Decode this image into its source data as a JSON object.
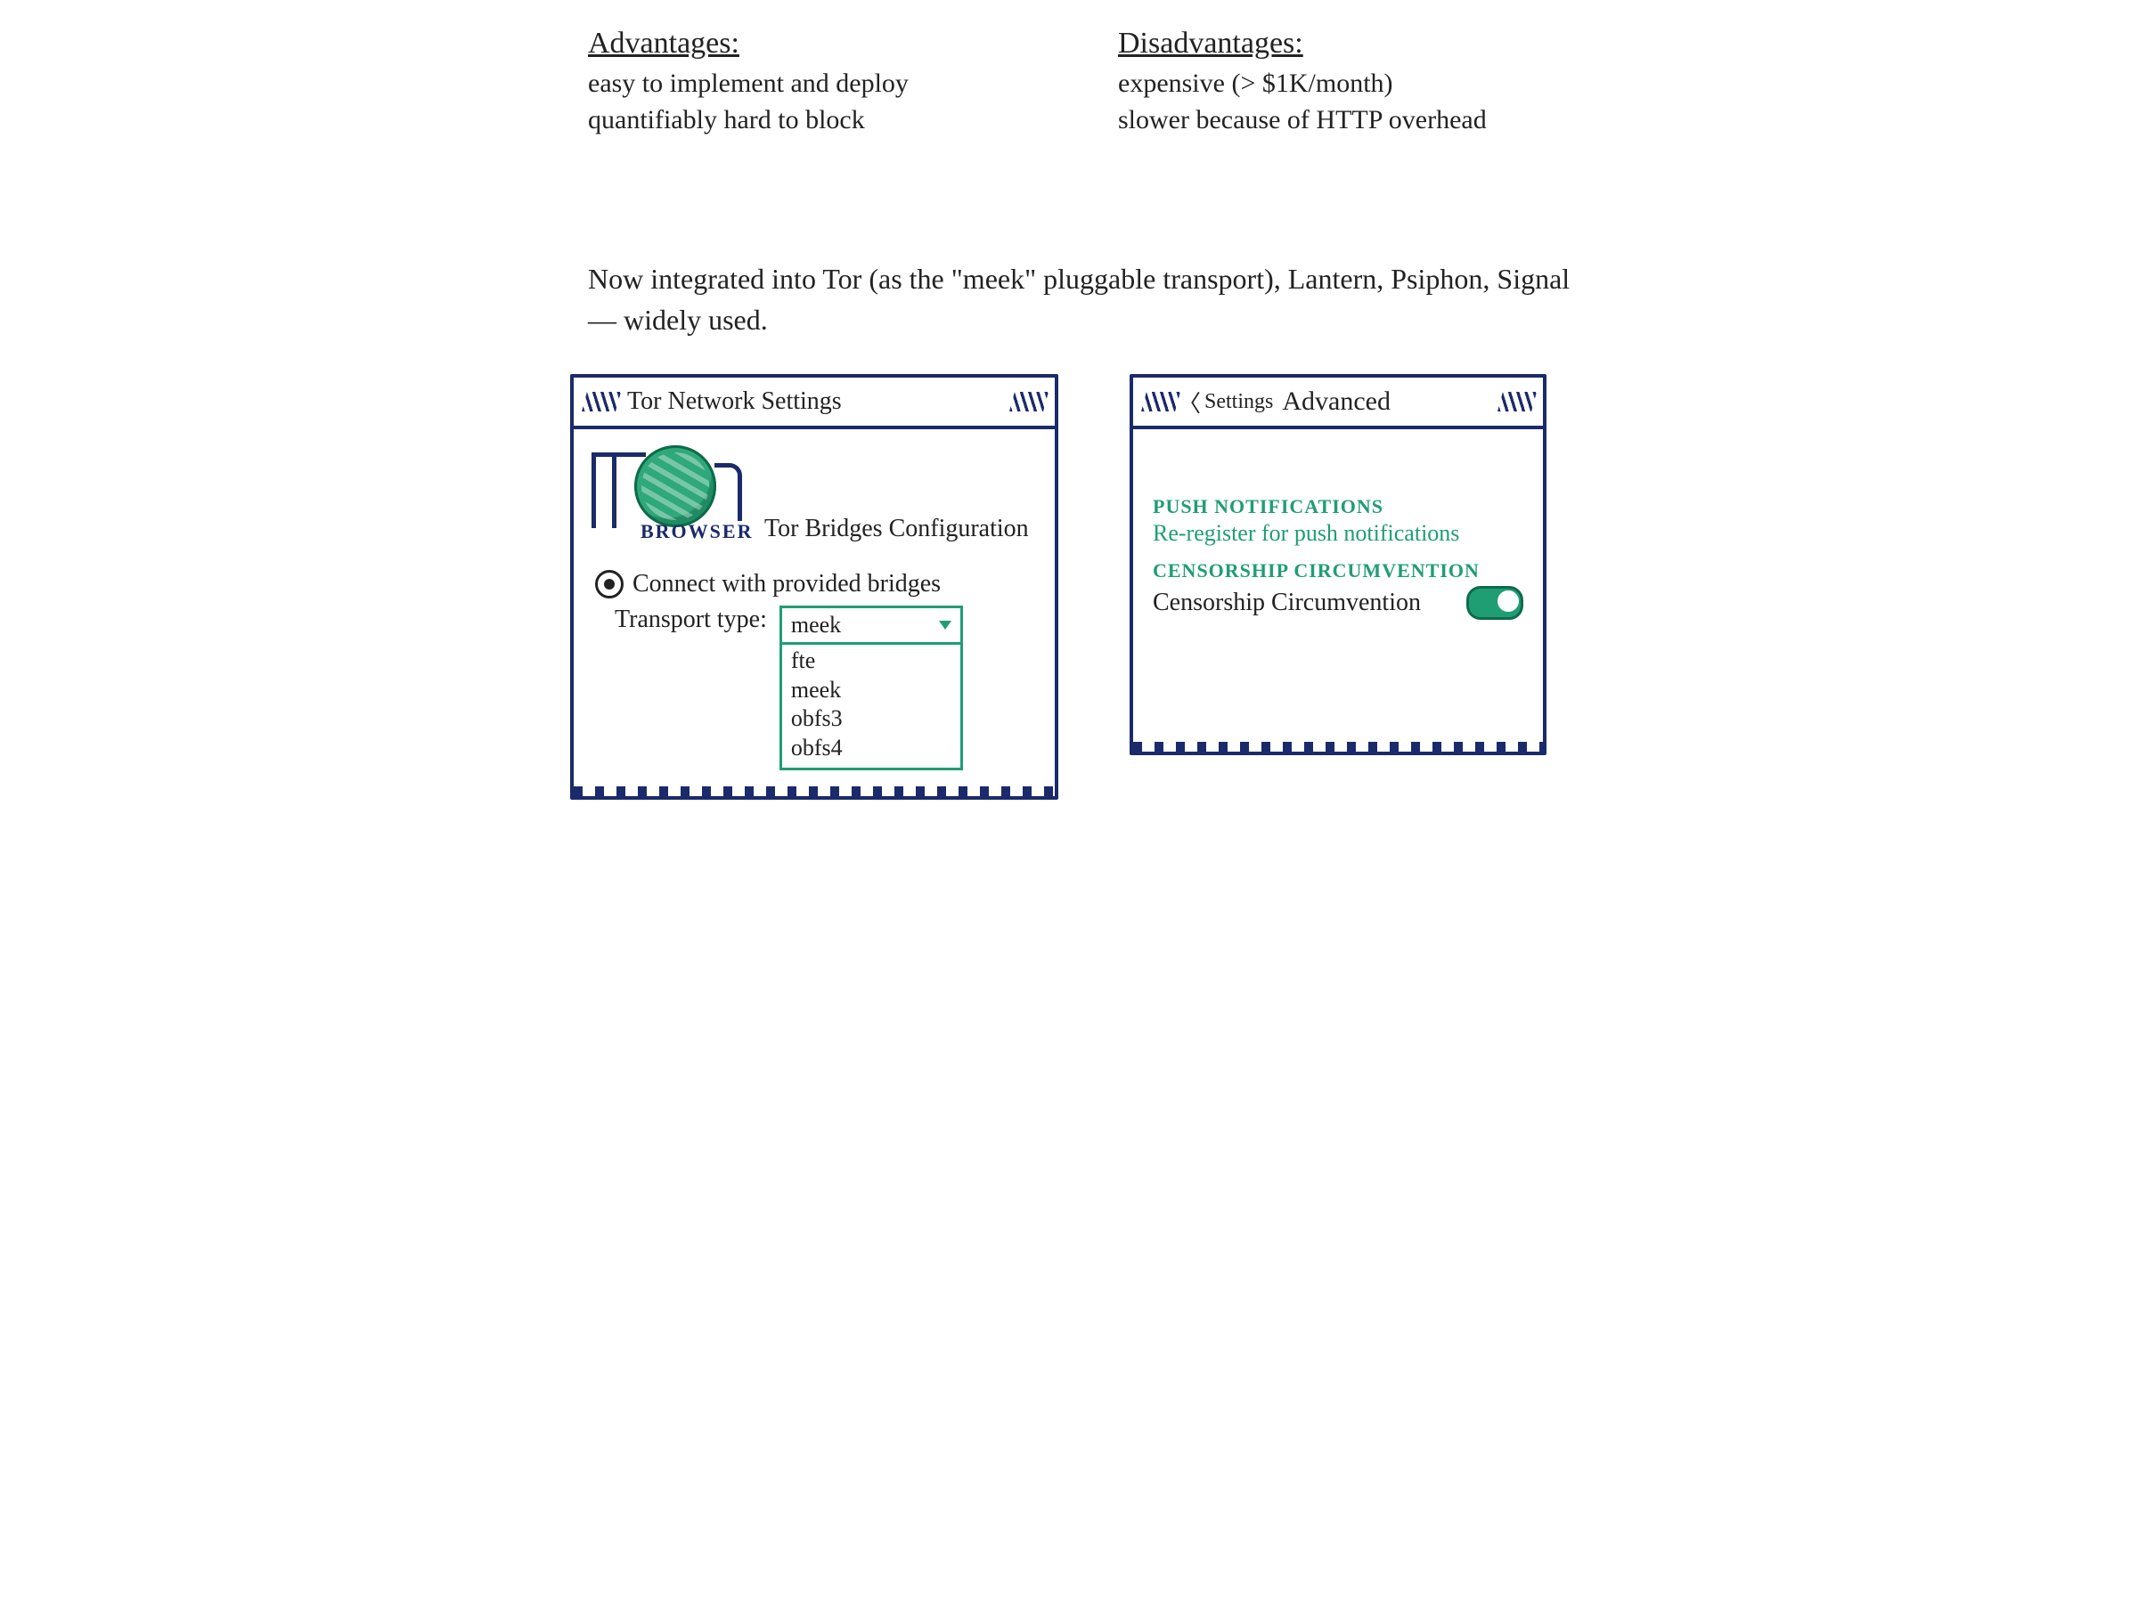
{
  "advantages": {
    "heading": "Advantages:",
    "lines": [
      "easy to implement and deploy",
      "quantifiably hard to block"
    ]
  },
  "disadvantages": {
    "heading": "Disadvantages:",
    "lines": [
      "expensive  (> $1K/month)",
      "slower because of HTTP overhead"
    ]
  },
  "integration_note": "Now integrated into Tor (as the \"meek\" pluggable transport), Lantern, Psiphon, Signal — widely used.",
  "tor_window": {
    "title": "Tor Network Settings",
    "logo_caption": "BROWSER",
    "bridges_heading": "Tor Bridges Configuration",
    "radio_label": "Connect with provided bridges",
    "transport_label": "Transport type:",
    "transport_selected": "meek",
    "transport_options": [
      "fte",
      "meek",
      "obfs3",
      "obfs4"
    ]
  },
  "signal_window": {
    "back_label": "Settings",
    "title": "Advanced",
    "push_section": "PUSH NOTIFICATIONS",
    "push_item": "Re-register for push notifications",
    "censorship_section": "CENSORSHIP CIRCUMVENTION",
    "censorship_item": "Censorship Circumvention",
    "toggle_on": true
  }
}
